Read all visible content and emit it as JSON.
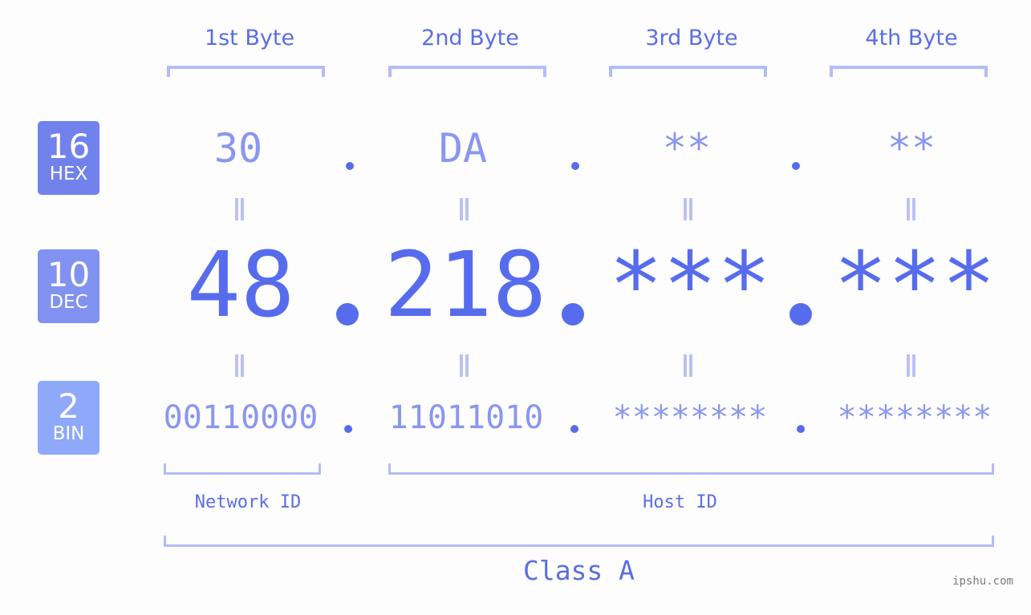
{
  "headers": [
    "1st Byte",
    "2nd Byte",
    "3rd Byte",
    "4th Byte"
  ],
  "bases": [
    {
      "number": "16",
      "label": "HEX",
      "color": "#7182ed"
    },
    {
      "number": "10",
      "label": "DEC",
      "color": "#8192f2"
    },
    {
      "number": "2",
      "label": "BIN",
      "color": "#8ea8fa"
    }
  ],
  "hex": [
    "30",
    "DA",
    "**",
    "**"
  ],
  "dec": [
    "48",
    "218",
    "***",
    "***"
  ],
  "bin": [
    "00110000",
    "11011010",
    "********",
    "********"
  ],
  "separator": ".",
  "equals_symbol": "=",
  "network_id_label": "Network ID",
  "host_id_label": "Host ID",
  "class_label": "Class A",
  "watermark": "ipshu.com",
  "colors": {
    "accent": "#576ced",
    "light_value": "#8a96ef",
    "bracket": "#b3bcf8",
    "background": "#fcfdfc"
  }
}
